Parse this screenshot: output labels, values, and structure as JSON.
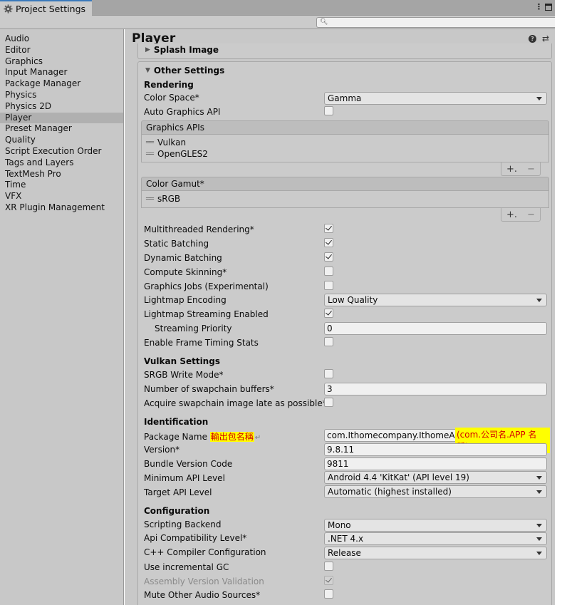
{
  "window": {
    "tab_title": "Project Settings",
    "menu_icon": "kebab-menu-icon",
    "maximize_icon": "maximize-icon"
  },
  "search": {
    "placeholder": ""
  },
  "sidebar": {
    "items": [
      {
        "label": "Audio"
      },
      {
        "label": "Editor"
      },
      {
        "label": "Graphics"
      },
      {
        "label": "Input Manager"
      },
      {
        "label": "Package Manager"
      },
      {
        "label": "Physics"
      },
      {
        "label": "Physics 2D"
      },
      {
        "label": "Player"
      },
      {
        "label": "Preset Manager"
      },
      {
        "label": "Quality"
      },
      {
        "label": "Script Execution Order"
      },
      {
        "label": "Tags and Layers"
      },
      {
        "label": "TextMesh Pro"
      },
      {
        "label": "Time"
      },
      {
        "label": "VFX"
      },
      {
        "label": "XR Plugin Management"
      }
    ],
    "selected": "Player"
  },
  "main": {
    "title": "Player",
    "splash_image": "Splash Image",
    "other_settings": "Other Settings",
    "rendering": {
      "header": "Rendering",
      "color_space_label": "Color Space*",
      "color_space_value": "Gamma",
      "auto_graphics_api_label": "Auto Graphics API",
      "graphics_apis_header": "Graphics APIs",
      "graphics_apis": [
        "Vulkan",
        "OpenGLES2"
      ],
      "color_gamut_header": "Color Gamut*",
      "color_gamut": [
        "sRGB"
      ],
      "add_label": "+.",
      "remove_label": "−",
      "multithreaded_label": "Multithreaded Rendering*",
      "static_batching_label": "Static Batching",
      "dynamic_batching_label": "Dynamic Batching",
      "compute_skinning_label": "Compute Skinning*",
      "graphics_jobs_label": "Graphics Jobs (Experimental)",
      "lightmap_encoding_label": "Lightmap Encoding",
      "lightmap_encoding_value": "Low Quality",
      "lightmap_streaming_label": "Lightmap Streaming Enabled",
      "streaming_priority_label": "Streaming Priority",
      "streaming_priority_value": "0",
      "frame_timing_label": "Enable Frame Timing Stats"
    },
    "vulkan": {
      "header": "Vulkan Settings",
      "srgb_write_label": "SRGB Write Mode*",
      "swapchain_label": "Number of swapchain buffers*",
      "swapchain_value": "3",
      "acquire_label": "Acquire swapchain image late as possible*"
    },
    "identification": {
      "header": "Identification",
      "package_name_label": "Package Name",
      "package_name_annotation": "輸出包名稱",
      "package_name_return": "↵",
      "package_name_value": "com.Ithomecompany.IthomeAR",
      "package_name_hint": "(com.公司名.APP 名稱)",
      "version_label": "Version*",
      "version_value": "9.8.11",
      "bundle_label": "Bundle Version Code",
      "bundle_value": "9811",
      "min_api_label": "Minimum API Level",
      "min_api_value": "Android 4.4 'KitKat' (API level 19)",
      "target_api_label": "Target API Level",
      "target_api_value": "Automatic (highest installed)"
    },
    "configuration": {
      "header": "Configuration",
      "scripting_label": "Scripting Backend",
      "scripting_value": "Mono",
      "api_compat_label": "Api Compatibility Level*",
      "api_compat_value": ".NET 4.x",
      "cpp_label": "C++ Compiler Configuration",
      "cpp_value": "Release",
      "incremental_gc_label": "Use incremental GC",
      "assembly_label": "Assembly Version Validation",
      "mute_label": "Mute Other Audio Sources*"
    }
  }
}
